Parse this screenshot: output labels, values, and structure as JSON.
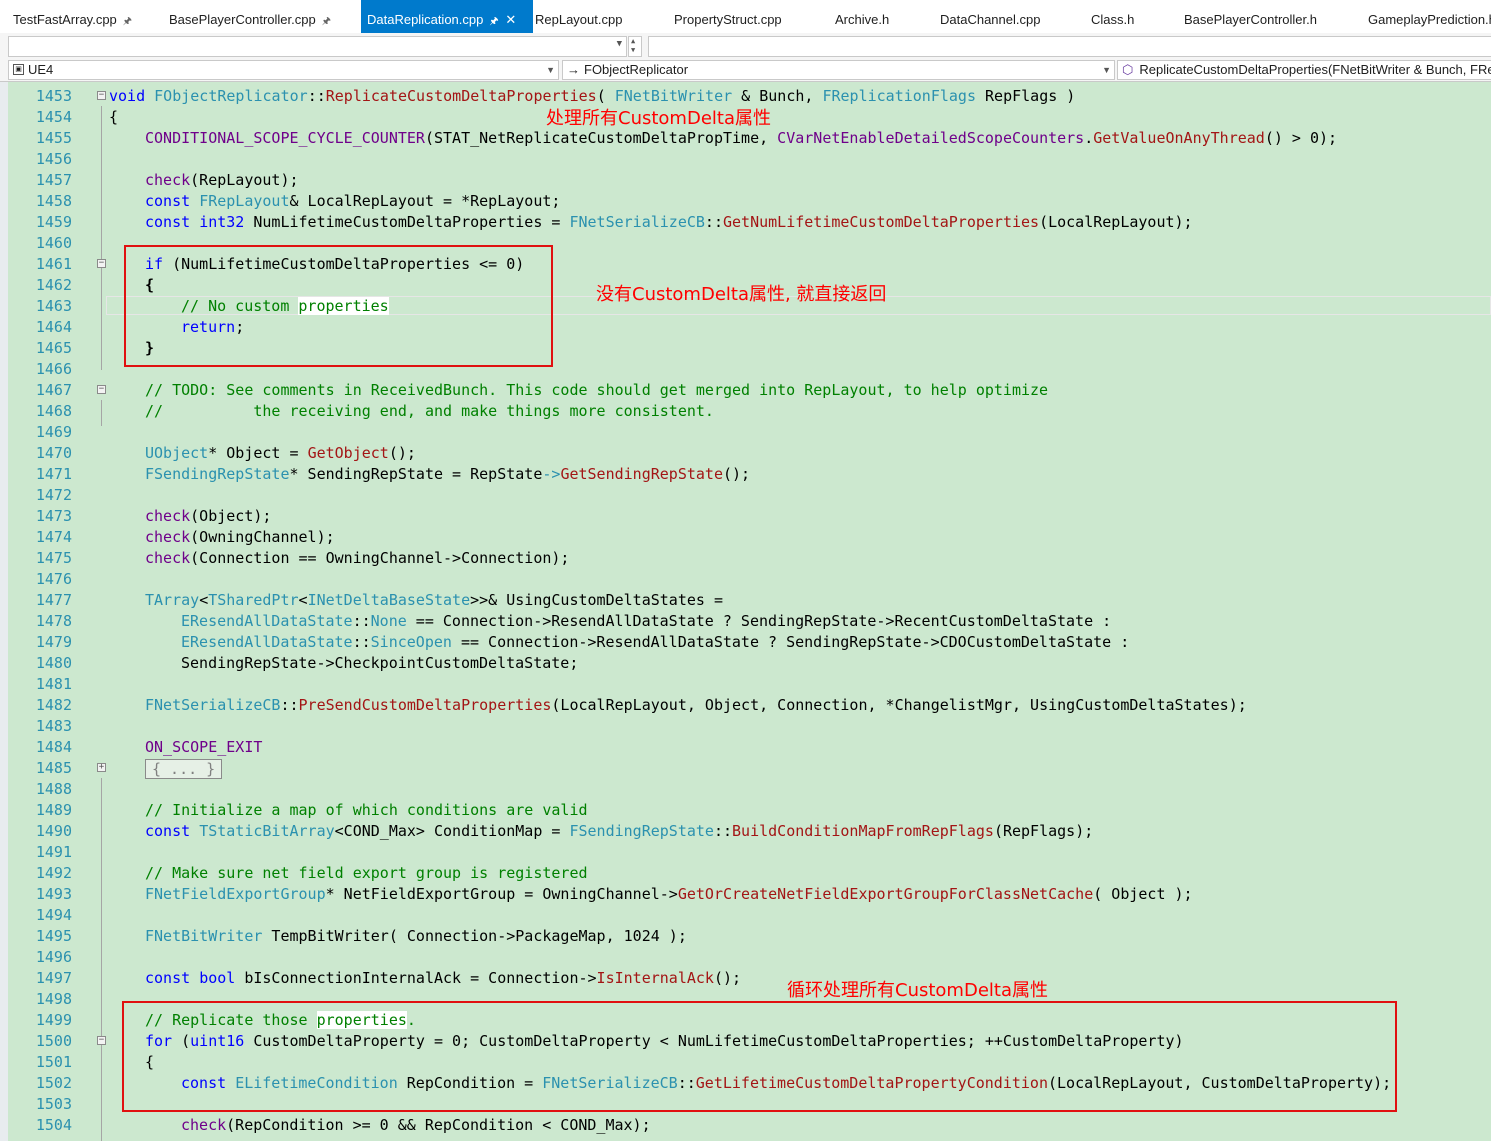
{
  "tabs": [
    {
      "label": "TestFastArray.cpp",
      "pinned": true,
      "active": false
    },
    {
      "label": "BasePlayerController.cpp",
      "pinned": true,
      "active": false
    },
    {
      "label": "DataReplication.cpp",
      "pinned": true,
      "active": true
    },
    {
      "label": "RepLayout.cpp",
      "pinned": false,
      "active": false
    },
    {
      "label": "PropertyStruct.cpp",
      "pinned": false,
      "active": false
    },
    {
      "label": "Archive.h",
      "pinned": false,
      "active": false
    },
    {
      "label": "DataChannel.cpp",
      "pinned": false,
      "active": false
    },
    {
      "label": "Class.h",
      "pinned": false,
      "active": false
    },
    {
      "label": "BasePlayerController.h",
      "pinned": false,
      "active": false
    },
    {
      "label": "GameplayPrediction.h",
      "pinned": false,
      "active": false
    }
  ],
  "navbar": {
    "project": "UE4",
    "scope": "FObjectReplicator",
    "member": "ReplicateCustomDeltaProperties(FNetBitWriter & Bunch, FReplicationFlags RepFlags)"
  },
  "annotations": {
    "a1": "处理所有CustomDelta属性",
    "a2": "没有CustomDelta属性, 就直接返回",
    "a3": "循环处理所有CustomDelta属性"
  },
  "code": {
    "l1453": "1453",
    "l1454": "1454",
    "l1455": "1455",
    "l1456": "1456",
    "l1457": "1457",
    "l1458": "1458",
    "l1459": "1459",
    "l1460": "1460",
    "l1461": "1461",
    "l1462": "1462",
    "l1463": "1463",
    "l1464": "1464",
    "l1465": "1465",
    "l1466": "1466",
    "l1467": "1467",
    "l1468": "1468",
    "l1469": "1469",
    "l1470": "1470",
    "l1471": "1471",
    "l1472": "1472",
    "l1473": "1473",
    "l1474": "1474",
    "l1475": "1475",
    "l1476": "1476",
    "l1477": "1477",
    "l1478": "1478",
    "l1479": "1479",
    "l1480": "1480",
    "l1481": "1481",
    "l1482": "1482",
    "l1483": "1483",
    "l1484": "1484",
    "l1485": "1485",
    "l1488": "1488",
    "l1489": "1489",
    "l1490": "1490",
    "l1491": "1491",
    "l1492": "1492",
    "l1493": "1493",
    "l1494": "1494",
    "l1495": "1495",
    "l1496": "1496",
    "l1497": "1497",
    "l1498": "1498",
    "l1499": "1499",
    "l1500": "1500",
    "l1501": "1501",
    "l1502": "1502",
    "l1503": "1503",
    "l1504": "1504",
    "t1453_a": "void",
    "t1453_b": " ",
    "t1453_c": "FObjectReplicator",
    "t1453_d": "::",
    "t1453_e": "ReplicateCustomDeltaProperties",
    "t1453_f": "( ",
    "t1453_g": "FNetBitWriter",
    "t1453_h": " & Bunch, ",
    "t1453_i": "FReplicationFlags",
    "t1453_j": " RepFlags )",
    "t1454_a": "{",
    "t1455_a": "CONDITIONAL_SCOPE_CYCLE_COUNTER",
    "t1455_b": "(STAT_NetReplicateCustomDeltaPropTime, ",
    "t1455_c": "CVarNetEnableDetailedScopeCounters",
    "t1455_d": ".",
    "t1455_e": "GetValueOnAnyThread",
    "t1455_f": "() > 0);",
    "t1457_a": "check",
    "t1457_b": "(RepLayout);",
    "t1458_a": "const",
    "t1458_b": " ",
    "t1458_c": "FRepLayout",
    "t1458_d": "& LocalRepLayout = *RepLayout;",
    "t1459_a": "const",
    "t1459_b": " ",
    "t1459_c": "int32",
    "t1459_d": " NumLifetimeCustomDeltaProperties = ",
    "t1459_e": "FNetSerializeCB",
    "t1459_f": "::",
    "t1459_g": "GetNumLifetimeCustomDeltaProperties",
    "t1459_h": "(LocalRepLayout);",
    "t1461_a": "if",
    "t1461_b": " (NumLifetimeCustomDeltaProperties <= 0)",
    "t1462_a": "{",
    "t1463_a": "// No custom ",
    "t1463_b": "properties",
    "t1464_a": "return",
    "t1464_b": ";",
    "t1465_a": "}",
    "t1467_a": "// TODO: See comments in ReceivedBunch. This code should get merged into RepLayout, to help optimize",
    "t1468_a": "//          the receiving end, and make things more consistent.",
    "t1470_a": "UObject",
    "t1470_b": "* Object = ",
    "t1470_c": "GetObject",
    "t1470_d": "();",
    "t1471_a": "FSendingRepState",
    "t1471_b": "* SendingRepState = RepState",
    "t1471_c": "->",
    "t1471_d": "GetSendingRepState",
    "t1471_e": "();",
    "t1473_a": "check",
    "t1473_b": "(Object);",
    "t1474_a": "check",
    "t1474_b": "(OwningChannel);",
    "t1475_a": "check",
    "t1475_b": "(Connection == OwningChannel->Connection);",
    "t1477_a": "TArray",
    "t1477_b": "<",
    "t1477_c": "TSharedPtr",
    "t1477_d": "<",
    "t1477_e": "INetDeltaBaseState",
    "t1477_f": ">>& UsingCustomDeltaStates =",
    "t1478_a": "EResendAllDataState",
    "t1478_b": "::",
    "t1478_c": "None",
    "t1478_d": " == Connection->ResendAllDataState ? SendingRepState->RecentCustomDeltaState :",
    "t1479_a": "EResendAllDataState",
    "t1479_b": "::",
    "t1479_c": "SinceOpen",
    "t1479_d": " == Connection->ResendAllDataState ? SendingRepState->CDOCustomDeltaState :",
    "t1480_a": "SendingRepState->CheckpointCustomDeltaState;",
    "t1482_a": "FNetSerializeCB",
    "t1482_b": "::",
    "t1482_c": "PreSendCustomDeltaProperties",
    "t1482_d": "(LocalRepLayout, Object, Connection, *ChangelistMgr, UsingCustomDeltaStates);",
    "t1484_a": "ON_SCOPE_EXIT",
    "t1485_a": "{ ... }",
    "t1489_a": "// Initialize a map of which conditions are valid",
    "t1490_a": "const",
    "t1490_b": " ",
    "t1490_c": "TStaticBitArray",
    "t1490_d": "<COND_Max> ConditionMap = ",
    "t1490_e": "FSendingRepState",
    "t1490_f": "::",
    "t1490_g": "BuildConditionMapFromRepFlags",
    "t1490_h": "(RepFlags);",
    "t1492_a": "// Make sure net field export group is registered",
    "t1493_a": "FNetFieldExportGroup",
    "t1493_b": "* NetFieldExportGroup = OwningChannel->",
    "t1493_c": "GetOrCreateNetFieldExportGroupForClassNetCache",
    "t1493_d": "( Object );",
    "t1495_a": "FNetBitWriter",
    "t1495_b": " TempBitWriter( Connection->PackageMap, 1024 );",
    "t1497_a": "const",
    "t1497_b": " ",
    "t1497_c": "bool",
    "t1497_d": " bIsConnectionInternalAck = Connection->",
    "t1497_e": "IsInternalAck",
    "t1497_f": "();",
    "t1499_a": "// Replicate those ",
    "t1499_b": "properties",
    "t1499_c": ".",
    "t1500_a": "for",
    "t1500_b": " (",
    "t1500_c": "uint16",
    "t1500_d": " CustomDeltaProperty = 0; CustomDeltaProperty < NumLifetimeCustomDeltaProperties; ++CustomDeltaProperty)",
    "t1501_a": "{",
    "t1502_a": "const",
    "t1502_b": " ",
    "t1502_c": "ELifetimeCondition",
    "t1502_d": " RepCondition = ",
    "t1502_e": "FNetSerializeCB",
    "t1502_f": "::",
    "t1502_g": "GetLifetimeCustomDeltaPropertyCondition",
    "t1502_h": "(LocalRepLayout, CustomDeltaProperty);",
    "t1504_a": "check",
    "t1504_b": "(RepCondition >= 0 && RepCondition < COND_Max);"
  },
  "colors": {
    "editor_bg": "#cce8cf",
    "line_number": "#2b91af",
    "keyword": "#0000ff",
    "type": "#2b91af",
    "function": "#a31515",
    "comment": "#008000",
    "annotation": "#ff0000",
    "tab_active": "#007acc"
  }
}
